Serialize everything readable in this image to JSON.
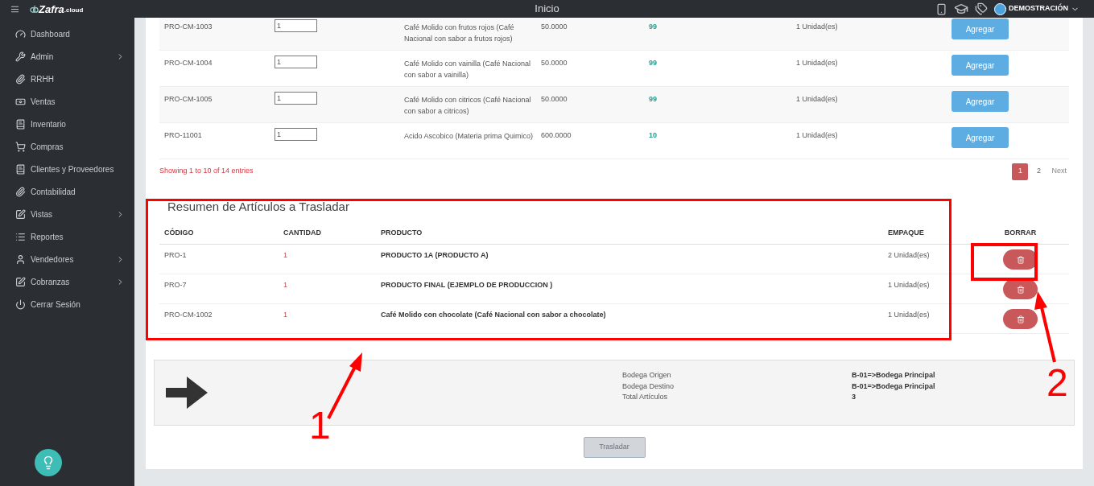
{
  "topbar": {
    "logo": "Zafra",
    "logo_suffix": ".cloud",
    "title": "Inicio",
    "user": "DEMOSTRACIÓN"
  },
  "sidebar": {
    "items": [
      {
        "label": "Dashboard",
        "expandable": false
      },
      {
        "label": "Admin",
        "expandable": true
      },
      {
        "label": "RRHH",
        "expandable": false
      },
      {
        "label": "Ventas",
        "expandable": false
      },
      {
        "label": "Inventario",
        "expandable": false
      },
      {
        "label": "Compras",
        "expandable": false
      },
      {
        "label": "Clientes y Proveedores",
        "expandable": false
      },
      {
        "label": "Contabilidad",
        "expandable": false
      },
      {
        "label": "Vistas",
        "expandable": true
      },
      {
        "label": "Reportes",
        "expandable": false
      },
      {
        "label": "Vendedores",
        "expandable": true
      },
      {
        "label": "Cobranzas",
        "expandable": true
      },
      {
        "label": "Cerrar Sesión",
        "expandable": false
      }
    ]
  },
  "products_table": {
    "rows": [
      {
        "code": "PRO-CM-1003",
        "quantity": "1",
        "product": "Café Molido con frutos rojos (Café Nacional con sabor a frutos rojos)",
        "price": "50.0000",
        "stock": "99",
        "unit": "1 Unidad(es)",
        "action": "Agregar"
      },
      {
        "code": "PRO-CM-1004",
        "quantity": "1",
        "product": "Café Molido con vainilla (Café Nacional con sabor a vainilla)",
        "price": "50.0000",
        "stock": "99",
        "unit": "1 Unidad(es)",
        "action": "Agregar"
      },
      {
        "code": "PRO-CM-1005",
        "quantity": "1",
        "product": "Café Molido con citricos (Café Nacional con sabor a citricos)",
        "price": "50.0000",
        "stock": "99",
        "unit": "1 Unidad(es)",
        "action": "Agregar"
      },
      {
        "code": "PRO-11001",
        "quantity": "1",
        "product": "Acido Ascobico (Materia prima Quimico)",
        "price": "600.0000",
        "stock": "10",
        "unit": "1 Unidad(es)",
        "action": "Agregar"
      }
    ],
    "info": "Showing 1 to 10 of 14 entries",
    "pages": [
      {
        "label": "1",
        "selected": true
      },
      {
        "label": "2",
        "selected": false
      }
    ],
    "next": "Next"
  },
  "summary_table": {
    "title": "Resumen de Artículos a Trasladar",
    "columns": [
      "CÓDIGO",
      "CANTIDAD",
      "PRODUCTO",
      "EMPAQUE",
      "BORRAR"
    ],
    "rows": [
      {
        "code": "PRO-1",
        "quantity": "1",
        "product": "PRODUCTO 1A (PRODUCTO A)",
        "package": "2 Unidad(es)"
      },
      {
        "code": "PRO-7",
        "quantity": "1",
        "product": "PRODUCTO FINAL (EJEMPLO DE PRODUCCION )",
        "package": "1 Unidad(es)"
      },
      {
        "code": "PRO-CM-1002",
        "quantity": "1",
        "product": "Café Molido con chocolate (Café Nacional con sabor a chocolate)",
        "package": "1 Unidad(es)"
      }
    ]
  },
  "transfer": {
    "fields": [
      {
        "label": "Bodega Origen",
        "value": "B-01=>Bodega Principal"
      },
      {
        "label": "Bodega Destino",
        "value": "B-01=>Bodega Principal"
      },
      {
        "label": "Total Artículos",
        "value": "3"
      }
    ],
    "button": {
      "label": "Trasladar",
      "disabled": true
    }
  },
  "annotations": [
    {
      "kind": "box"
    },
    {
      "kind": "box"
    },
    {
      "kind": "arrow",
      "label": "1"
    },
    {
      "kind": "arrow",
      "label": "2"
    }
  ]
}
